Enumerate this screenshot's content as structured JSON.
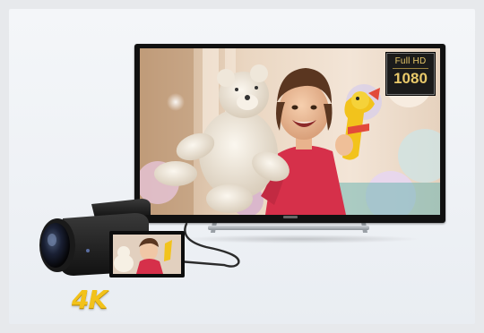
{
  "scene": {
    "tv_badge": {
      "line1": "Full HD",
      "line2": "1080"
    },
    "camcorder_badge": "4K",
    "colors": {
      "background": "#e9ecef",
      "panel": "#f1f4f8",
      "badge_gold": "#e9c96a",
      "fourk_yellow": "#f2c21a"
    }
  }
}
